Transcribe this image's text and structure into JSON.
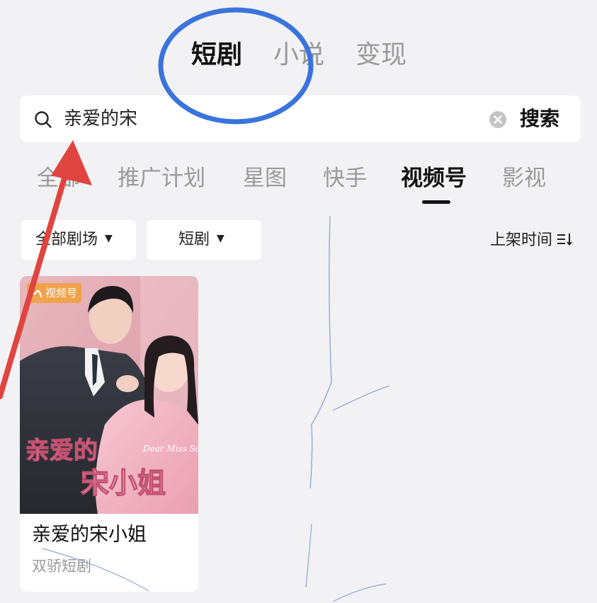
{
  "top_tabs": [
    {
      "label": "短剧",
      "active": true
    },
    {
      "label": "小说",
      "active": false
    },
    {
      "label": "变现",
      "active": false
    }
  ],
  "search": {
    "value": "亲爱的宋",
    "button_label": "搜索"
  },
  "platform_tabs": [
    {
      "label": "全部",
      "active": false
    },
    {
      "label": "推广计划",
      "active": false
    },
    {
      "label": "星图",
      "active": false
    },
    {
      "label": "快手",
      "active": false
    },
    {
      "label": "视频号",
      "active": true
    },
    {
      "label": "影视",
      "active": false
    }
  ],
  "filters": {
    "theater": "全部剧场",
    "category": "短剧",
    "sort_label": "上架时间"
  },
  "card": {
    "platform_badge": "视频号",
    "poster_title_cn_line1": "亲爱的",
    "poster_title_cn_line2": "宋小姐",
    "poster_title_en": "Dear Miss Song",
    "title": "亲爱的宋小姐",
    "producer": "双骄短剧"
  },
  "icons": {
    "search": "search-icon",
    "clear": "clear-icon",
    "caret": "caret-down-icon",
    "sort": "sort-icon",
    "badge": "channels-icon"
  },
  "colors": {
    "annotation_circle": "#3a73db",
    "annotation_arrow": "#e0443f",
    "badge": "#f1a24a"
  }
}
